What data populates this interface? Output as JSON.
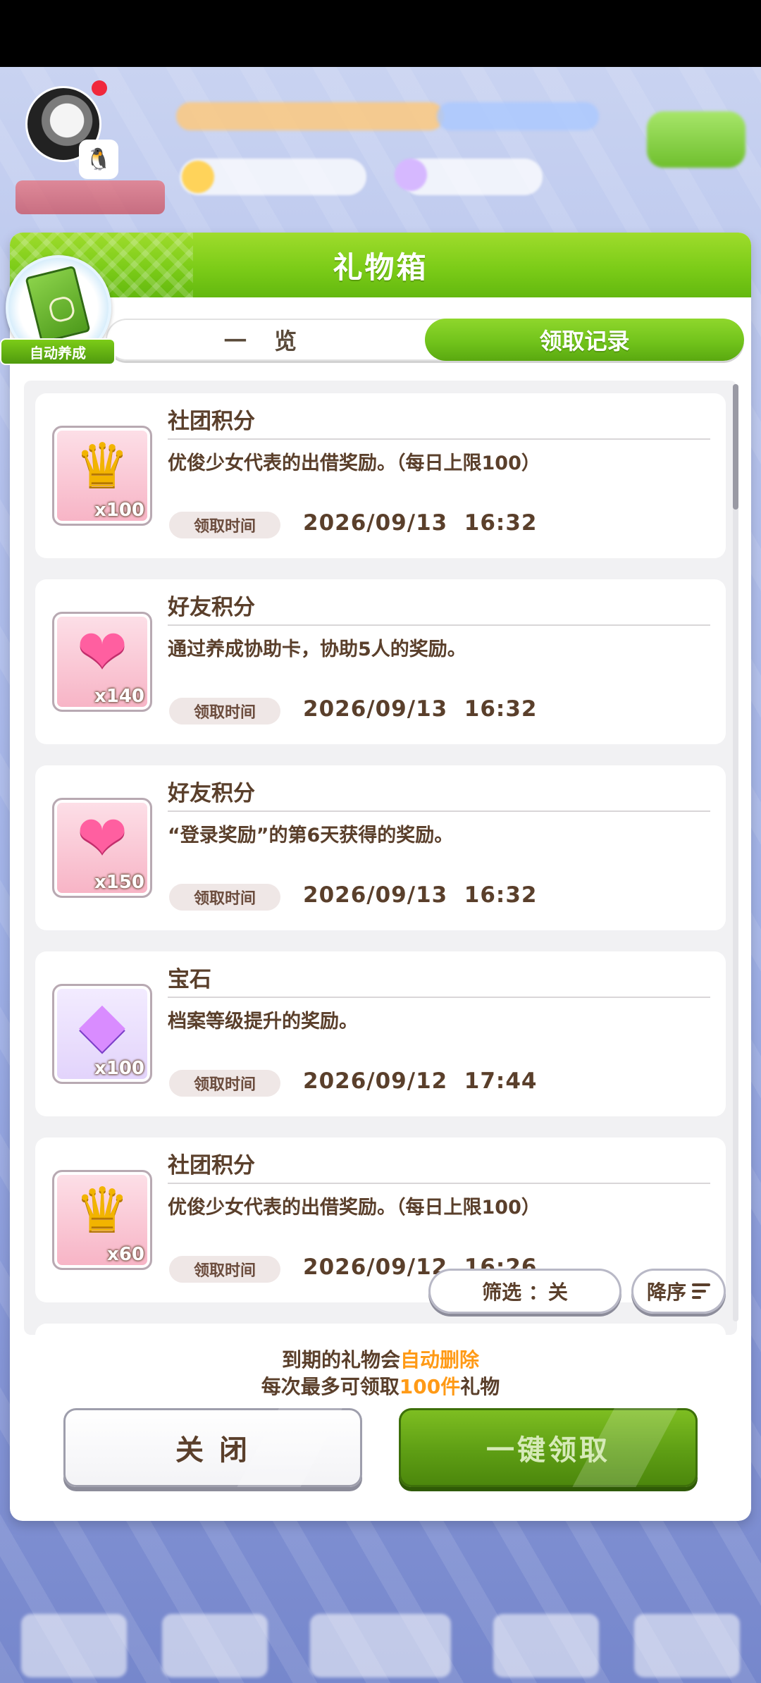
{
  "dialog": {
    "title": "礼物箱",
    "tabs": [
      {
        "label": "一 览",
        "active": false
      },
      {
        "label": "领取记录",
        "active": true
      }
    ],
    "auto_train_badge": "自动养成"
  },
  "items": [
    {
      "name": "社团积分",
      "icon": "crown-icon",
      "quantity": "x100",
      "description": "优俊少女代表的出借奖励。（每日上限100）",
      "time_label": "领取时间",
      "time": "2026/09/13  16:32"
    },
    {
      "name": "好友积分",
      "icon": "handshake-icon",
      "quantity": "x140",
      "description": "通过养成协助卡，协助5人的奖励。",
      "time_label": "领取时间",
      "time": "2026/09/13  16:32"
    },
    {
      "name": "好友积分",
      "icon": "handshake-icon",
      "quantity": "x150",
      "description": "“登录奖励”的第6天获得的奖励。",
      "time_label": "领取时间",
      "time": "2026/09/13  16:32"
    },
    {
      "name": "宝石",
      "icon": "gem-icon",
      "quantity": "x100",
      "description": "档案等级提升的奖励。",
      "time_label": "领取时间",
      "time": "2026/09/12  17:44"
    },
    {
      "name": "社团积分",
      "icon": "crown-icon",
      "quantity": "x60",
      "description": "优俊少女代表的出借奖励。（每日上限100）",
      "time_label": "领取时间",
      "time": "2026/09/12  16:26"
    }
  ],
  "filter_button": "筛选 ：关",
  "sort_button": "降序",
  "footer": {
    "line1_prefix": "到期的礼物会",
    "line1_highlight": "自动删除",
    "line2_prefix": "每次最多可领取",
    "line2_highlight": "100件",
    "line2_suffix": "礼物"
  },
  "buttons": {
    "close": "关 闭",
    "claim_all": "一键领取"
  },
  "colors": {
    "accent_green": "#7ccc18",
    "text_brown": "#5a3f2b",
    "highlight_orange": "#ff9a16"
  }
}
